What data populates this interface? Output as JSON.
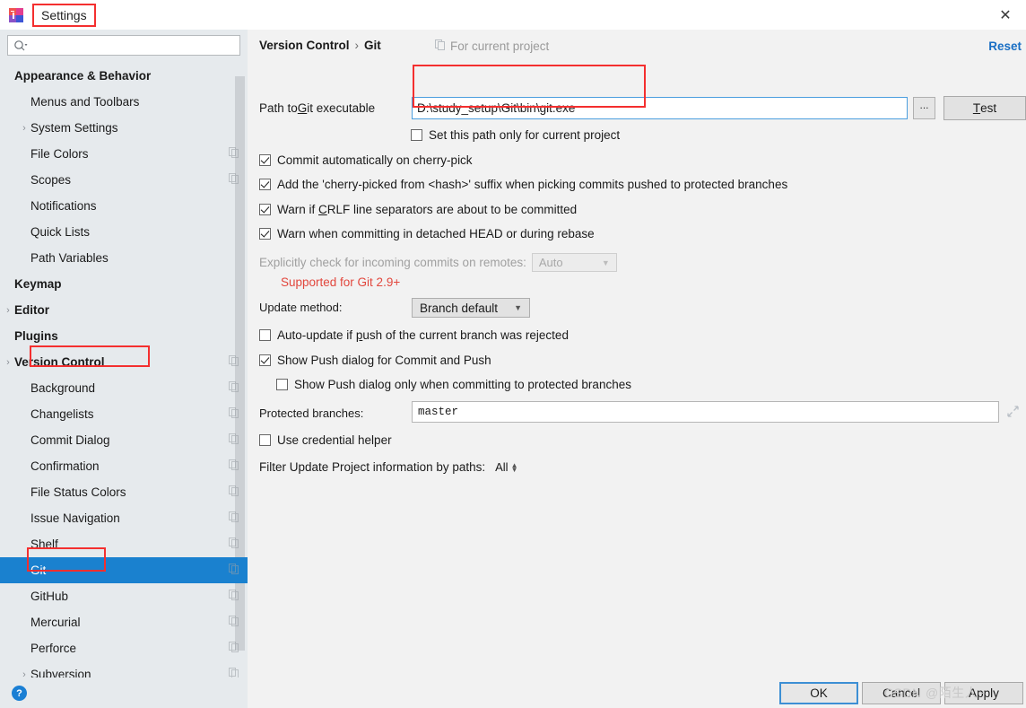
{
  "window": {
    "title": "Settings",
    "app_icon": "intellij-idea-icon",
    "close_icon": "close-icon"
  },
  "sidebar": {
    "search": {
      "placeholder": "",
      "value": "",
      "icon": "search-icon"
    },
    "items": [
      {
        "label": "Appearance & Behavior",
        "level": 0,
        "bold": true,
        "arrow": false,
        "copy": false,
        "selected": false
      },
      {
        "label": "Menus and Toolbars",
        "level": 1,
        "bold": false,
        "arrow": false,
        "copy": false,
        "selected": false
      },
      {
        "label": "System Settings",
        "level": 1,
        "bold": false,
        "arrow": true,
        "copy": false,
        "selected": false
      },
      {
        "label": "File Colors",
        "level": 1,
        "bold": false,
        "arrow": false,
        "copy": true,
        "selected": false
      },
      {
        "label": "Scopes",
        "level": 1,
        "bold": false,
        "arrow": false,
        "copy": true,
        "selected": false
      },
      {
        "label": "Notifications",
        "level": 1,
        "bold": false,
        "arrow": false,
        "copy": false,
        "selected": false
      },
      {
        "label": "Quick Lists",
        "level": 1,
        "bold": false,
        "arrow": false,
        "copy": false,
        "selected": false
      },
      {
        "label": "Path Variables",
        "level": 1,
        "bold": false,
        "arrow": false,
        "copy": false,
        "selected": false
      },
      {
        "label": "Keymap",
        "level": 0,
        "bold": true,
        "arrow": false,
        "copy": false,
        "selected": false
      },
      {
        "label": "Editor",
        "level": 0,
        "bold": true,
        "arrow": true,
        "copy": false,
        "selected": false
      },
      {
        "label": "Plugins",
        "level": 0,
        "bold": true,
        "arrow": false,
        "copy": false,
        "selected": false
      },
      {
        "label": "Version Control",
        "level": 0,
        "bold": true,
        "arrow": true,
        "copy": true,
        "selected": false
      },
      {
        "label": "Background",
        "level": 1,
        "bold": false,
        "arrow": false,
        "copy": true,
        "selected": false
      },
      {
        "label": "Changelists",
        "level": 1,
        "bold": false,
        "arrow": false,
        "copy": true,
        "selected": false
      },
      {
        "label": "Commit Dialog",
        "level": 1,
        "bold": false,
        "arrow": false,
        "copy": true,
        "selected": false
      },
      {
        "label": "Confirmation",
        "level": 1,
        "bold": false,
        "arrow": false,
        "copy": true,
        "selected": false
      },
      {
        "label": "File Status Colors",
        "level": 1,
        "bold": false,
        "arrow": false,
        "copy": true,
        "selected": false
      },
      {
        "label": "Issue Navigation",
        "level": 1,
        "bold": false,
        "arrow": false,
        "copy": true,
        "selected": false
      },
      {
        "label": "Shelf",
        "level": 1,
        "bold": false,
        "arrow": false,
        "copy": true,
        "selected": false
      },
      {
        "label": "Git",
        "level": 1,
        "bold": false,
        "arrow": false,
        "copy": true,
        "selected": true
      },
      {
        "label": "GitHub",
        "level": 1,
        "bold": false,
        "arrow": false,
        "copy": true,
        "selected": false
      },
      {
        "label": "Mercurial",
        "level": 1,
        "bold": false,
        "arrow": false,
        "copy": true,
        "selected": false
      },
      {
        "label": "Perforce",
        "level": 1,
        "bold": false,
        "arrow": false,
        "copy": true,
        "selected": false
      },
      {
        "label": "Subversion",
        "level": 1,
        "bold": false,
        "arrow": true,
        "copy": true,
        "selected": false
      }
    ]
  },
  "main": {
    "breadcrumb": {
      "parent": "Version Control",
      "separator": "›",
      "current": "Git"
    },
    "for_current_project": "For current project",
    "reset_label": "Reset",
    "path": {
      "label_pre": "Path to ",
      "label_accel": "G",
      "label_post": "it executable",
      "value": "D:\\study_setup\\Git\\bin\\git.exe",
      "browse_label": "...",
      "test_accel": "T",
      "test_rest": "est"
    },
    "set_path_only": {
      "label": "Set this path only for current project",
      "checked": false
    },
    "checkboxes": [
      {
        "label": "Commit automatically on cherry-pick",
        "checked": true
      },
      {
        "label": "Add the 'cherry-picked from <hash>' suffix when picking commits pushed to protected branches",
        "checked": true
      },
      {
        "label_pre": "Warn if ",
        "accel": "C",
        "label_post": "RLF line separators are about to be committed",
        "checked": true
      },
      {
        "label": "Warn when committing in detached HEAD or during rebase",
        "checked": true
      }
    ],
    "explicit_check": {
      "label": "Explicitly check for incoming commits on remotes:",
      "value": "Auto",
      "disabled": true
    },
    "supported_note": "Supported for Git 2.9+",
    "update_method": {
      "label": "Update method:",
      "value": "Branch default"
    },
    "auto_update": {
      "label_pre": "Auto-update if ",
      "accel": "p",
      "label_post": "ush of the current branch was rejected",
      "checked": false
    },
    "show_push_dialog": {
      "label": "Show Push dialog for Commit and Push",
      "checked": true
    },
    "show_push_protected": {
      "label": "Show Push dialog only when committing to protected branches",
      "checked": false
    },
    "protected_branches": {
      "label": "Protected branches:",
      "value": "master",
      "expand_icon": "expand-icon"
    },
    "credential_helper": {
      "label": "Use credential helper",
      "checked": false
    },
    "filter_update": {
      "label": "Filter Update Project information by paths:",
      "value": "All"
    }
  },
  "footer": {
    "help_label": "?",
    "ok_label": "OK",
    "cancel_label": "Cancel",
    "apply_label": "Apply"
  },
  "watermark": "CSDN @陌生人~",
  "colors": {
    "selection_blue": "#1a81cf",
    "link_blue": "#1a6fc4",
    "warning_red": "#e2473d",
    "annotation_red": "#f42f2f",
    "sidebar_bg": "#e6eaed",
    "main_bg": "#f2f2f2"
  }
}
